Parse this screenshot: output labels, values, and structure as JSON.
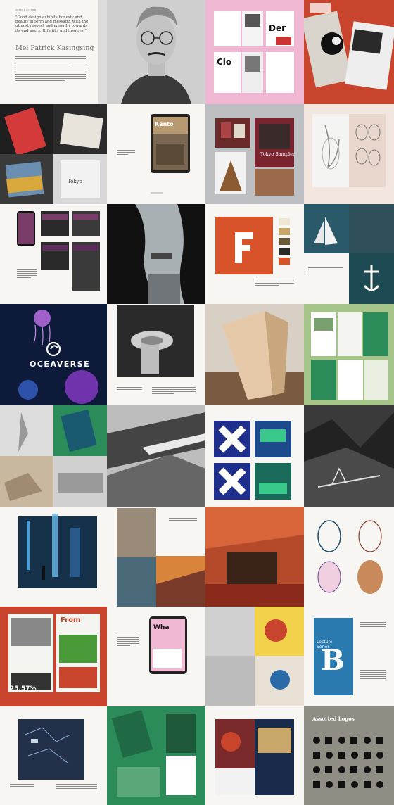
{
  "intro": {
    "eyebrow": "INTRODUCTION",
    "quote": "\"Good design exhibits honesty and beauty in form and message, with the utmost respect and empathy towards its end users. It fulfills and inspires.\"",
    "author": "Mel Patrick Kasingsing"
  },
  "kanto": {
    "app_title": "Kanto"
  },
  "tokyo": {
    "title": "Tokyo Sampler"
  },
  "oceaverse": {
    "wordmark": "OCEAVERSE"
  },
  "posters": {
    "from": "From",
    "lecture": "Lecture\nSeries",
    "big_number": "25.57%"
  },
  "logos": {
    "title": "Assorted Logos"
  },
  "colors": {
    "pink": "#f1b8d4",
    "red_accent": "#c8442c",
    "orange": "#d8532a",
    "green": "#2b8c5a",
    "sage": "#a4c48a",
    "logo_bg": "#8f8d84",
    "navy": "#0e1a3a"
  }
}
